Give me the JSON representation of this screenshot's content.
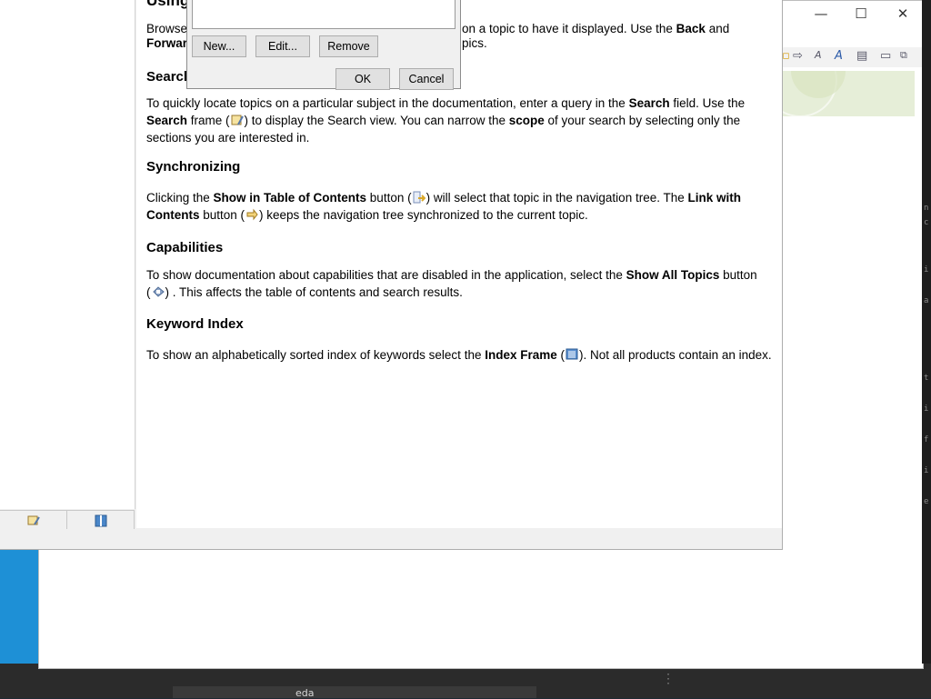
{
  "outer_window": {
    "controls": {
      "minimize": "—",
      "maximize": "☐",
      "close": "✕"
    },
    "bottom_run_label": "eda"
  },
  "help_page": {
    "intro_partial_left": "Browse",
    "intro_partial_right": "on a topic to have it displayed. Use the",
    "intro_back": "Back",
    "intro_and": "and",
    "intro_line2_left": "Forwar",
    "intro_line2_right": "pics.",
    "title_partial": "Using",
    "sections": {
      "search": {
        "heading": "Search",
        "t1": "To quickly locate topics on a particular subject in the documentation, enter a query in the ",
        "b1": "Search",
        "t2": " field. Use the",
        "b2": "Search",
        "t3": " frame (",
        "t4": ") to display the Search view. You can narrow the ",
        "b3": "scope",
        "t5": " of your search by selecting only the",
        "t6": "sections you are interested in."
      },
      "sync": {
        "heading": "Synchronizing",
        "t1": "Clicking the ",
        "b1": "Show in Table of Contents",
        "t2": " button (",
        "t3": ") will select that topic in the navigation tree. The ",
        "b2": "Link with",
        "b3": "Contents",
        "t4": " button (",
        "t5": ") keeps the navigation tree synchronized to the current topic."
      },
      "capabilities": {
        "heading": "Capabilities",
        "t1": "To show documentation about capabilities that are disabled in the application, select the ",
        "b1": "Show All Topics",
        "t2": " button",
        "t3": "(",
        "t4": ") . This affects the table of contents and search results."
      },
      "index": {
        "heading": "Keyword Index",
        "t1": "To show an alphabetically sorted index of keywords select the ",
        "b1": "Index Frame",
        "t2": " (",
        "t3": "). Not all products contain an index."
      }
    }
  },
  "dialog": {
    "buttons": {
      "new": "New...",
      "edit": "Edit...",
      "remove": "Remove",
      "ok": "OK",
      "cancel": "Cancel"
    }
  },
  "icons": {
    "search_frame": "search-frame-icon",
    "show_in_toc": "show-in-toc-icon",
    "link_with_contents": "link-with-contents-icon",
    "show_all_topics": "show-all-topics-icon",
    "index_frame": "index-frame-icon"
  },
  "colors": {
    "accent_blue": "#1e90d6",
    "icon_gold": "#d9a82a"
  }
}
